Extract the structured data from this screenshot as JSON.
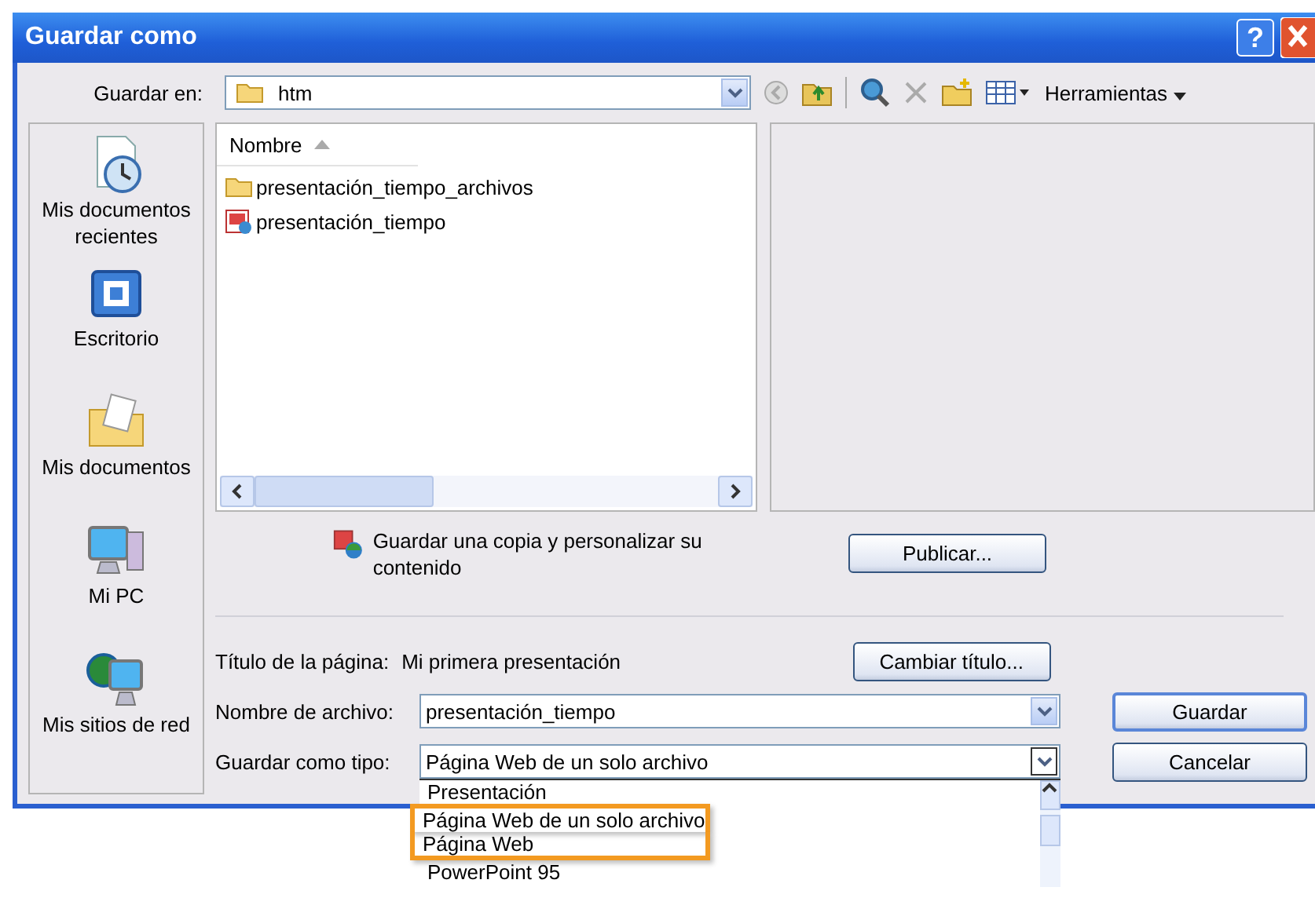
{
  "window": {
    "title": "Guardar como",
    "help_button": "?"
  },
  "toolbar": {
    "location_label": "Guardar en:",
    "location": "htm",
    "tools_menu": "Herramientas"
  },
  "places": [
    {
      "kind": "recent",
      "label": "Mis documentos recientes"
    },
    {
      "kind": "desktop",
      "label": "Escritorio"
    },
    {
      "kind": "documents",
      "label": "Mis documentos"
    },
    {
      "kind": "computer",
      "label": "Mi PC"
    },
    {
      "kind": "network",
      "label": "Mis sitios de red"
    }
  ],
  "file_list": {
    "column": "Nombre",
    "items": [
      {
        "kind": "folder",
        "name": "presentación_tiempo_archivos"
      },
      {
        "kind": "presentation",
        "name": "presentación_tiempo"
      }
    ]
  },
  "save_copy": {
    "text": "Guardar una copia y personalizar su contenido",
    "button": "Publicar..."
  },
  "page_title": {
    "label": "Título de la página:",
    "value": "Mi primera presentación",
    "button": "Cambiar título..."
  },
  "file_name": {
    "label": "Nombre de archivo:",
    "value": "presentación_tiempo"
  },
  "file_type": {
    "label": "Guardar como tipo:",
    "value": "Página Web de un solo archivo",
    "expanded": true,
    "options": [
      {
        "label": "Presentación",
        "highlighted": false
      },
      {
        "label": "Página Web de un solo archivo",
        "highlighted": true
      },
      {
        "label": "Página Web",
        "highlighted": true
      },
      {
        "label": "PowerPoint 95",
        "highlighted": false
      }
    ]
  },
  "buttons": {
    "save": "Guardar",
    "cancel": "Cancelar"
  }
}
